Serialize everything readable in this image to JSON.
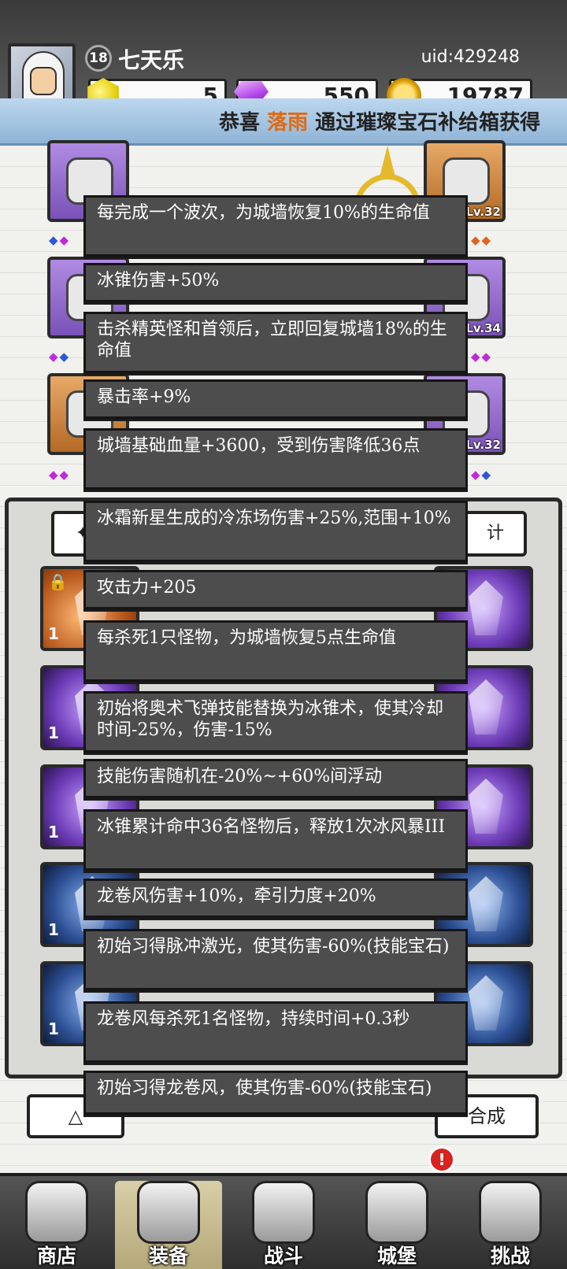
{
  "player": {
    "level": "18",
    "name": "七天乐",
    "uid": "uid:429248"
  },
  "currencies": [
    {
      "icon": "yellow-gem-icon",
      "value": "5"
    },
    {
      "icon": "purple-diamond-icon",
      "value": "550"
    },
    {
      "icon": "gold-coin-icon",
      "value": "19787"
    }
  ],
  "banner": {
    "prefix": "恭喜",
    "player": "落雨",
    "suffix": "通过璀璨宝石补给箱获得"
  },
  "equipment_slots": [
    {
      "name": "left-slot-1",
      "level": ""
    },
    {
      "name": "right-slot-1",
      "level": "Lv.32"
    },
    {
      "name": "left-slot-2",
      "level": ""
    },
    {
      "name": "right-slot-2",
      "level": "Lv.34"
    },
    {
      "name": "left-slot-3",
      "level": ""
    },
    {
      "name": "right-slot-3",
      "level": "Lv.32"
    }
  ],
  "inventory": {
    "counts": [
      "1",
      "1",
      "1",
      "1",
      "1",
      "1"
    ],
    "combine_label": "合成",
    "stats_label": "计"
  },
  "tooltip_lines": [
    "每完成一个波次，为城墙恢复10%的生命值",
    "冰锥伤害+50%",
    "击杀精英怪和首领后，立即回复城墙18%的生命值",
    "暴击率+9%",
    "城墙基础血量+3600，受到伤害降低36点",
    "冰霜新星生成的冷冻场伤害+25%,范围+10%",
    "攻击力+205",
    "每杀死1只怪物，为城墙恢复5点生命值",
    "初始将奥术飞弹技能替换为冰锥术，使其冷却时间-25%，伤害-15%",
    "技能伤害随机在-20%~+60%间浮动",
    "冰锥累计命中36名怪物后，释放1次冰风暴III",
    "龙卷风伤害+10%，牵引力度+20%",
    "初始习得脉冲激光，使其伤害-60%(技能宝石)",
    "龙卷风每杀死1名怪物，持续时间+0.3秒",
    "初始习得龙卷风，使其伤害-60%(技能宝石)"
  ],
  "nav": {
    "tabs": [
      {
        "label": "商店",
        "icon": "shop-icon"
      },
      {
        "label": "装备",
        "icon": "backpack-icon"
      },
      {
        "label": "战斗",
        "icon": "crossed-swords-icon"
      },
      {
        "label": "城堡",
        "icon": "castle-icon"
      },
      {
        "label": "挑战",
        "icon": "shield-icon"
      }
    ],
    "active": "装备",
    "alert": "!"
  }
}
